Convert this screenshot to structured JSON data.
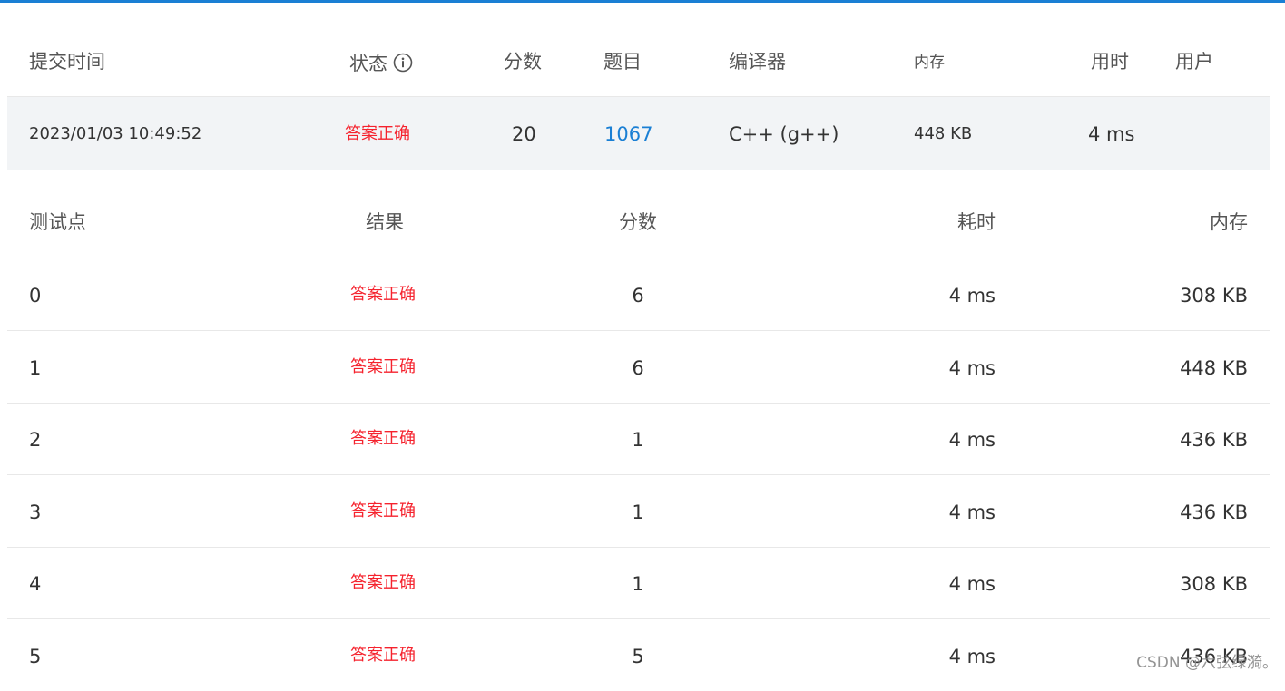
{
  "submission": {
    "headers": {
      "time": "提交时间",
      "status": "状态",
      "score": "分数",
      "problem": "题目",
      "compiler": "编译器",
      "memory": "内存",
      "duration": "用时",
      "user": "用户"
    },
    "row": {
      "time": "2023/01/03 10:49:52",
      "status": "答案正确",
      "score": "20",
      "problem": "1067",
      "compiler": "C++ (g++)",
      "memory": "448 KB",
      "duration": "4 ms",
      "user": ""
    }
  },
  "testcases": {
    "headers": {
      "point": "测试点",
      "result": "结果",
      "score": "分数",
      "time": "耗时",
      "memory": "内存"
    },
    "rows": [
      {
        "point": "0",
        "result": "答案正确",
        "score": "6",
        "time": "4 ms",
        "memory": "308 KB"
      },
      {
        "point": "1",
        "result": "答案正确",
        "score": "6",
        "time": "4 ms",
        "memory": "448 KB"
      },
      {
        "point": "2",
        "result": "答案正确",
        "score": "1",
        "time": "4 ms",
        "memory": "436 KB"
      },
      {
        "point": "3",
        "result": "答案正确",
        "score": "1",
        "time": "4 ms",
        "memory": "436 KB"
      },
      {
        "point": "4",
        "result": "答案正确",
        "score": "1",
        "time": "4 ms",
        "memory": "308 KB"
      },
      {
        "point": "5",
        "result": "答案正确",
        "score": "5",
        "time": "4 ms",
        "memory": "436 KB"
      }
    ]
  },
  "watermark": "CSDN @六弦绿漪。",
  "colors": {
    "accent": "#1a7fd4",
    "success_text": "#f5222d",
    "row_bg": "#f2f4f6"
  },
  "icons": {
    "status_info": "info-circle-icon"
  }
}
